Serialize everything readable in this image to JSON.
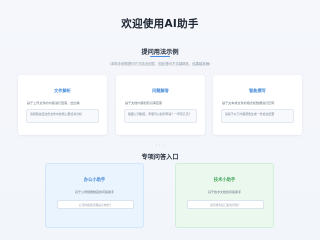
{
  "page": {
    "title": "欢迎使用AI助手"
  },
  "examples": {
    "heading": "提问用法示例",
    "subtitle": "（本助手依照提问方式给出回答，因此提问方式越精准，结果越准确）",
    "cards": [
      {
        "title": "文件解析",
        "desc": "基于上传文件的内容进行回答，给出精",
        "example": "请帮我总结这份文件中的核心要点并分析"
      },
      {
        "title": "问题解答",
        "desc": "基于文档内容和知识库回答",
        "example": "根据公司制度，年假可以如何申请？一年有几天？"
      },
      {
        "title": "智能撰写",
        "desc": "基于文本或文件的格式和数据进行回写",
        "example": "请基于以下内容帮我生成一份会议纪要"
      }
    ],
    "dots": "• • •"
  },
  "entries": {
    "heading": "专项问答入口",
    "items": [
      {
        "title": "办公小助手",
        "desc": "基于公司规章制度的问答助手",
        "placeholder": "公司的报销流程是怎样的？"
      },
      {
        "title": "技术小助手",
        "desc": "基于技术文档的问答助手",
        "placeholder": "如何排查接口超时问题？"
      }
    ]
  },
  "colors": {
    "accent": "#4a8ed8",
    "green": "#46a85e",
    "background": "#f4f6fa"
  }
}
